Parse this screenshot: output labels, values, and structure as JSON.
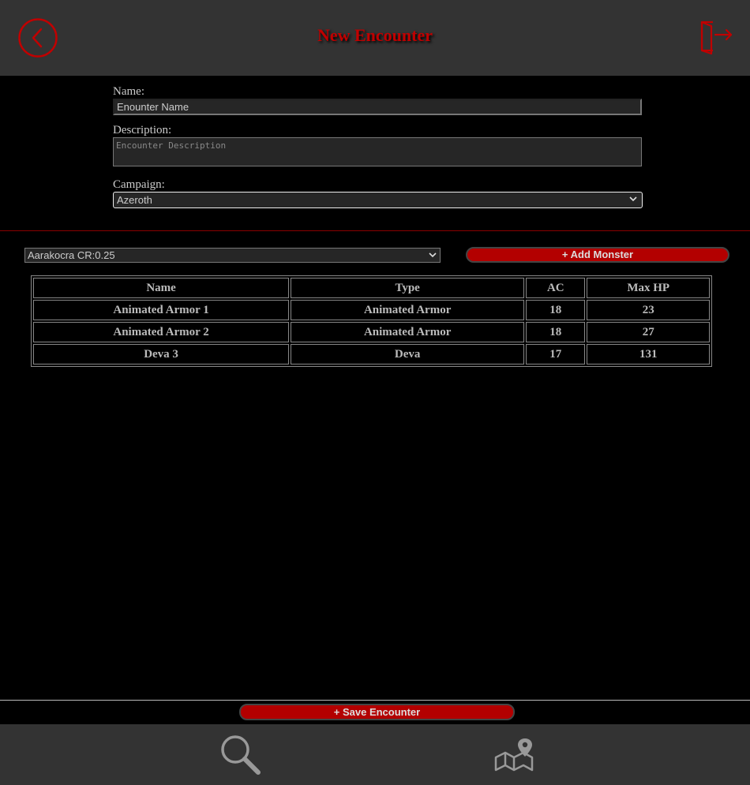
{
  "header": {
    "title": "New Encounter",
    "back_icon": "back-arrow-circle-icon",
    "logout_icon": "logout-door-icon"
  },
  "form": {
    "name_label": "Name:",
    "name_value": "Enounter Name",
    "description_label": "Description:",
    "description_placeholder": "Encounter Description",
    "campaign_label": "Campaign:",
    "campaign_selected": "Azeroth"
  },
  "monster_picker": {
    "selected": "Aarakocra CR:0.25",
    "add_label": "+ Add Monster"
  },
  "table": {
    "headers": [
      "Name",
      "Type",
      "AC",
      "Max HP"
    ],
    "rows": [
      [
        "Animated Armor 1",
        "Animated Armor",
        "18",
        "23"
      ],
      [
        "Animated Armor 2",
        "Animated Armor",
        "18",
        "27"
      ],
      [
        "Deva 3",
        "Deva",
        "17",
        "131"
      ]
    ]
  },
  "footer": {
    "save_label": "+ Save Encounter",
    "nav_search_icon": "search-icon",
    "nav_map_icon": "map-pin-icon"
  },
  "colors": {
    "accent": "#b30000",
    "title": "#c00000",
    "bar_bg": "#333333",
    "page_bg": "#000000"
  }
}
